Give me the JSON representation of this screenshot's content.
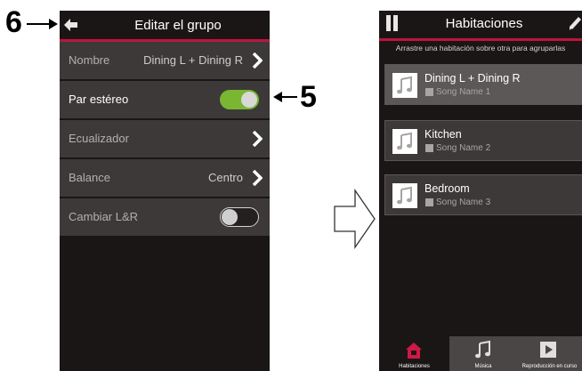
{
  "callouts": {
    "back_number": "6",
    "toggle_number": "5"
  },
  "edit_group": {
    "title": "Editar el grupo",
    "rows": [
      {
        "label": "Nombre",
        "value": "Dining L + Dining R"
      },
      {
        "label": "Par estéreo",
        "toggle": "on"
      },
      {
        "label": "Ecualizador"
      },
      {
        "label": "Balance",
        "value": "Centro"
      },
      {
        "label": "Cambiar L&R",
        "toggle": "off"
      }
    ]
  },
  "rooms_screen": {
    "title": "Habitaciones",
    "hint": "Arrastre una habitación sobre otra para agruparlas",
    "rooms": [
      {
        "name": "Dining L + Dining R",
        "song": "Song Name 1"
      },
      {
        "name": "Kitchen",
        "song": "Song Name 2"
      },
      {
        "name": "Bedroom",
        "song": "Song Name 3"
      }
    ],
    "tabs": [
      "Habitaciones",
      "Música",
      "Reproducción en curso"
    ]
  },
  "colors": {
    "accent_red": "#c0143c",
    "toggle_green": "#7ab632",
    "panel": "#1b1616",
    "row": "#3d3939"
  },
  "icons": [
    "back-arrow-icon",
    "chevron-right-icon",
    "music-note-icon",
    "pause-icon",
    "edit-pencil-icon",
    "home-icon",
    "play-icon"
  ]
}
